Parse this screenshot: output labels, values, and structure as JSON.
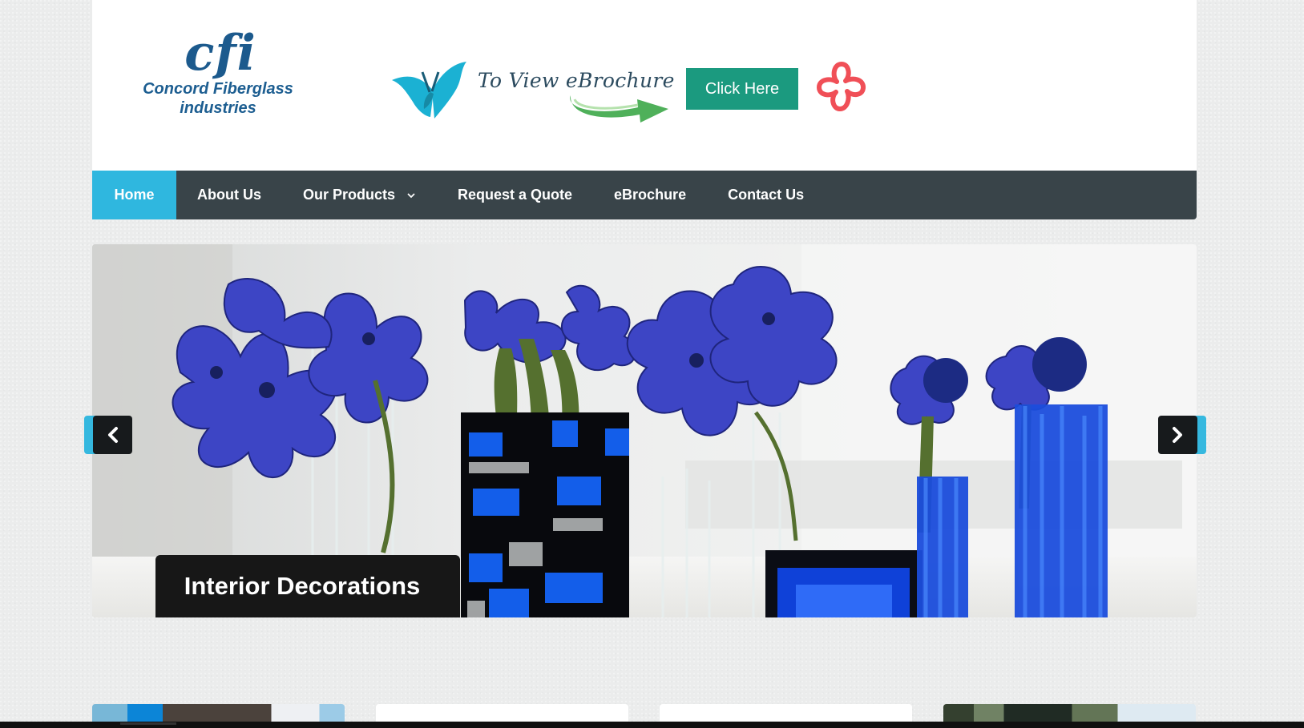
{
  "logo": {
    "mark": "cfi",
    "line1": "Concord Fiberglass",
    "line2": "industries"
  },
  "promo": {
    "text": "To View eBrochure",
    "button": "Click Here",
    "icons": {
      "left": "butterfly-icon",
      "right": "flower-icon",
      "arrow": "curved-arrow-icon"
    }
  },
  "nav": {
    "items": [
      {
        "label": "Home",
        "active": true
      },
      {
        "label": "About Us"
      },
      {
        "label": "Our Products",
        "has_dropdown": true
      },
      {
        "label": "Request a Quote"
      },
      {
        "label": "eBrochure"
      },
      {
        "label": "Contact Us"
      }
    ]
  },
  "slider": {
    "caption": "Interior Decorations",
    "controls": {
      "prev_icon": "chevron-left-icon",
      "next_icon": "chevron-right-icon"
    }
  },
  "colors": {
    "nav_bg": "#394449",
    "active_nav": "#2fb7df",
    "button": "#1b9a7f",
    "logo": "#1d5e91"
  }
}
